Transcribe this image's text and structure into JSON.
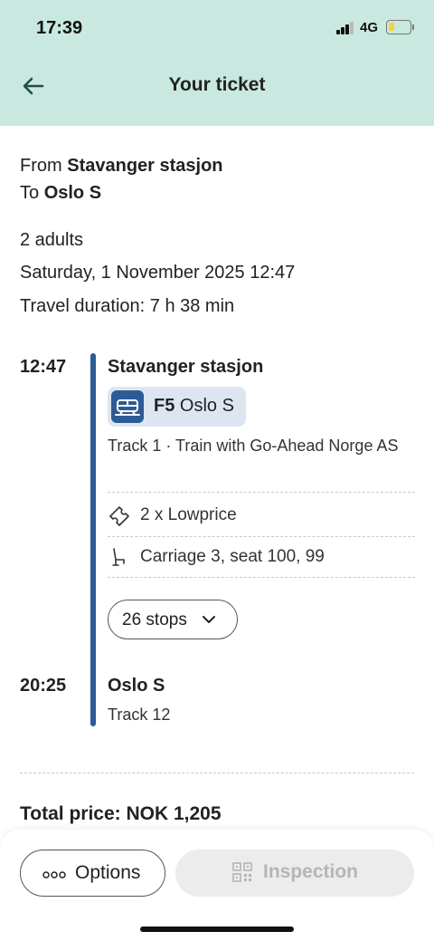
{
  "status_bar": {
    "time": "17:39",
    "network": "4G"
  },
  "header": {
    "title": "Your ticket",
    "back_icon": "arrow-left-icon"
  },
  "route": {
    "from_label": "From",
    "from_value": "Stavanger stasjon",
    "to_label": "To",
    "to_value": "Oslo S"
  },
  "travellers": "2 adults",
  "date_time": "Saturday, 1 November 2025 12:47",
  "duration": "Travel duration: 7 h 38 min",
  "departure": {
    "time": "12:47",
    "station": "Stavanger stasjon",
    "line_code": "F5",
    "line_destination": "Oslo S",
    "track_info": "Track 1 · Train with Go-Ahead Norge AS"
  },
  "details": {
    "fare": "2 x Lowprice",
    "seat": "Carriage 3, seat 100, 99",
    "stops_label": "26 stops"
  },
  "arrival": {
    "time": "20:25",
    "station": "Oslo S",
    "track": "Track 12"
  },
  "total_price": "Total price: NOK 1,205",
  "actions": {
    "options_label": "Options",
    "inspection_label": "Inspection"
  },
  "colors": {
    "header_bg": "#c9e8e0",
    "accent_blue": "#2d5b96",
    "chip_bg": "#dde6f0"
  }
}
